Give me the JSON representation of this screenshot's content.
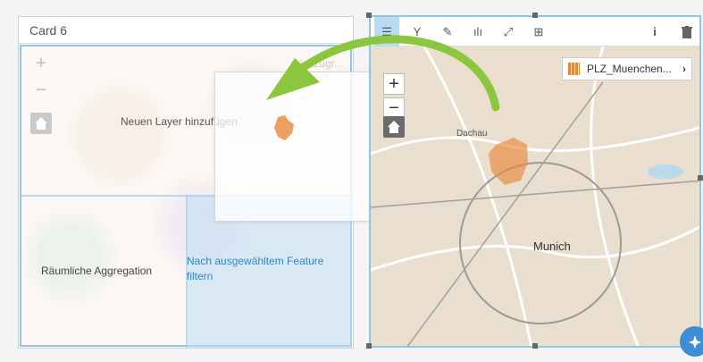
{
  "card6": {
    "title": "Card 6",
    "ghost_legend": "Nezzugr...",
    "drop_zones": {
      "add_layer": "Neuen Layer hinzufügen",
      "spatial_aggregation": "Räumliche Aggregation",
      "filter_by_feature": "Nach ausgewähltem Feature filtern"
    }
  },
  "map_card": {
    "toolbar": [
      {
        "icon": "list-icon",
        "glyph": "☰",
        "active": true
      },
      {
        "icon": "filter-icon",
        "glyph": "Y"
      },
      {
        "icon": "style-icon",
        "glyph": "✎"
      },
      {
        "icon": "chart-icon",
        "glyph": "ılı"
      },
      {
        "icon": "expand-icon",
        "glyph": "⤢"
      },
      {
        "icon": "add-card-icon",
        "glyph": "⊞"
      }
    ],
    "info_glyph": "i",
    "legend_label": "PLZ_Muenchen...",
    "legend_chevron": "›",
    "zoom_in": "+",
    "zoom_out": "−",
    "places": {
      "dachau": "Dachau",
      "munich": "Munich"
    }
  },
  "colors": {
    "accent": "#8ec6ea",
    "highlight": "#e8873a",
    "arrow": "#8cc63f",
    "fab": "#3e8ed6"
  }
}
